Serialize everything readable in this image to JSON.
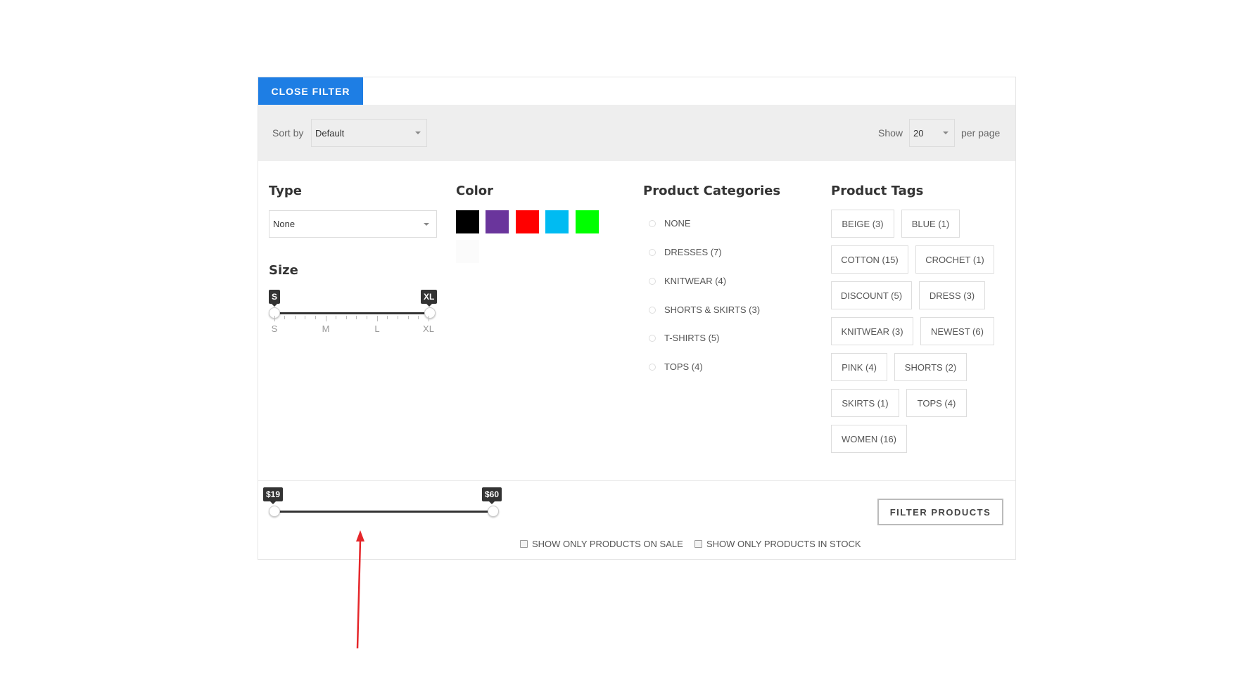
{
  "filter": {
    "close_label": "CLOSE FILTER"
  },
  "toolbar": {
    "sort_label": "Sort by",
    "sort_value": "Default",
    "show_label": "Show",
    "show_value": "20",
    "per_page_label": "per page"
  },
  "type": {
    "heading": "Type",
    "value": "None"
  },
  "size": {
    "heading": "Size",
    "min_tip": "S",
    "max_tip": "XL",
    "labels": [
      "S",
      "M",
      "L",
      "XL"
    ]
  },
  "color": {
    "heading": "Color",
    "swatches": [
      "#000000",
      "#6a359c",
      "#ff0000",
      "#00bbf2",
      "#00ff00",
      "#fbfbfb"
    ]
  },
  "categories": {
    "heading": "Product Categories",
    "items": [
      "NONE",
      "DRESSES (7)",
      "KNITWEAR (4)",
      "SHORTS & SKIRTS (3)",
      "T-SHIRTS (5)",
      "TOPS (4)"
    ]
  },
  "tags": {
    "heading": "Product Tags",
    "items": [
      "BEIGE (3)",
      "BLUE (1)",
      "COTTON (15)",
      "CROCHET (1)",
      "DISCOUNT (5)",
      "DRESS (3)",
      "KNITWEAR (3)",
      "NEWEST (6)",
      "PINK (4)",
      "SHORTS (2)",
      "SKIRTS (1)",
      "TOPS (4)",
      "WOMEN (16)"
    ]
  },
  "price": {
    "min_label": "$19",
    "max_label": "$60"
  },
  "actions": {
    "filter_label": "FILTER PRODUCTS",
    "on_sale_label": "SHOW ONLY PRODUCTS ON SALE",
    "in_stock_label": "SHOW ONLY PRODUCTS IN STOCK"
  },
  "colors": {
    "accent": "#1e7ee4",
    "annotation": "#e5262a"
  }
}
